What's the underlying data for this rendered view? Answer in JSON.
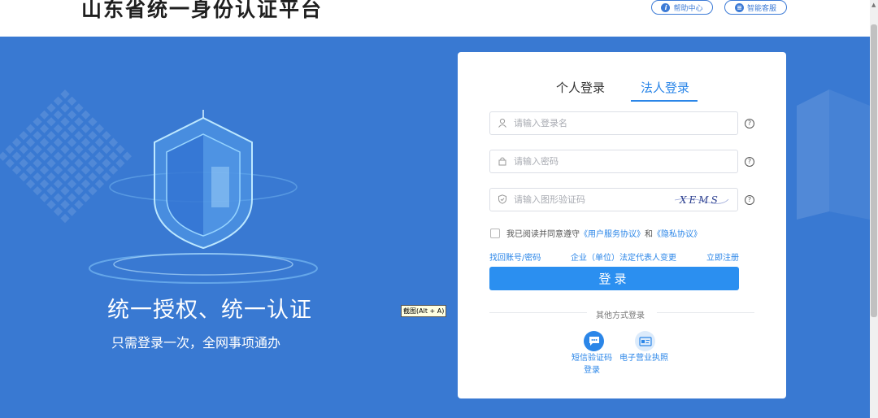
{
  "header": {
    "site_title": "山东省统一身份认证平台",
    "help_center": "帮助中心",
    "smart_service": "智能客服"
  },
  "banner": {
    "slogan_main": "统一授权、统一认证",
    "slogan_sub": "只需登录一次，全网事项通办"
  },
  "tooltip": "截图(Alt + A)",
  "login": {
    "tabs": [
      {
        "label": "个人登录",
        "active": false
      },
      {
        "label": "法人登录",
        "active": true
      }
    ],
    "username": {
      "placeholder": "请输入登录名",
      "value": ""
    },
    "password": {
      "placeholder": "请输入密码",
      "value": ""
    },
    "captcha": {
      "placeholder": "请输入图形验证码",
      "value": "",
      "image_text": "XEMS"
    },
    "agreement": {
      "prefix": "我已阅读并同意遵守",
      "terms_link": "《用户服务协议》",
      "conjunction": "和",
      "privacy_link": "《隐私协议》",
      "checked": false
    },
    "links": {
      "recover": "找回账号/密码",
      "change_rep": "企业（单位）法定代表人变更",
      "register": "立即注册"
    },
    "submit_label": "登录",
    "other_methods": {
      "label": "其他方式登录",
      "sms_line1": "短信验证码",
      "sms_line2": "登录",
      "license": "电子营业执照"
    }
  },
  "colors": {
    "brand_blue": "#3979d2",
    "accent": "#2b86e8",
    "button": "#2b8ff0"
  },
  "icons": [
    "info-icon",
    "service-icon",
    "user-icon",
    "lock-icon",
    "shield-check-icon",
    "help-icon",
    "chat-icon",
    "license-icon"
  ]
}
